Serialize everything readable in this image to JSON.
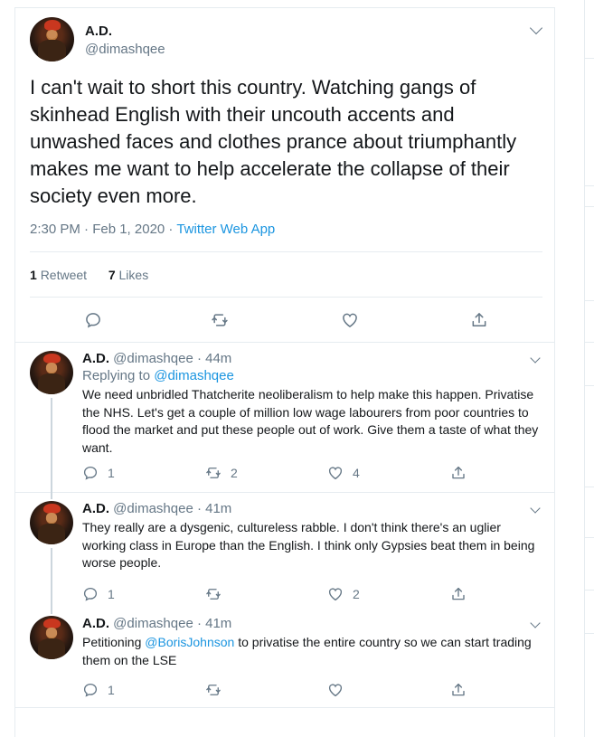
{
  "main_tweet": {
    "name": "A.D.",
    "handle": "@dimashqee",
    "text": "I can't wait to short this country. Watching gangs of skinhead English with their uncouth accents and unwashed faces and clothes prance about triumphantly makes me want to help accelerate the collapse of their society even more.",
    "timestamp": "2:30 PM · Feb 1, 2020 · ",
    "source": "Twitter Web App",
    "retweet_count": "1",
    "retweet_label": "Retweet",
    "like_count": "7",
    "like_label": "Likes"
  },
  "replies": [
    {
      "name": "A.D.",
      "handle_time": "@dimashqee · 44m",
      "replying_prefix": "Replying to ",
      "replying_handle": "@dimashqee",
      "text": "We need unbridled Thatcherite neoliberalism to help make this happen. Privatise the NHS. Let's get a couple of million low wage labourers from poor countries to flood the market and put these people out of work. Give them a taste of what they want.",
      "reply_count": "1",
      "retweet_count": "2",
      "like_count": "4"
    },
    {
      "name": "A.D.",
      "handle_time": "@dimashqee · 41m",
      "text": "They really are a dysgenic, cultureless rabble. I don't think there's an uglier working class in Europe than the English. I think only Gypsies beat them in being worse people.",
      "reply_count": "1",
      "retweet_count": "",
      "like_count": "2"
    },
    {
      "name": "A.D.",
      "handle_time": "@dimashqee · 41m",
      "text_before": "Petitioning ",
      "mention": "@BorisJohnson",
      "text_after": " to privatise the entire country so we can start trading them on the LSE",
      "reply_count": "1",
      "retweet_count": "",
      "like_count": ""
    }
  ],
  "icons": {
    "reply": "reply-icon",
    "retweet": "retweet-icon",
    "like": "heart-icon",
    "share": "share-icon",
    "more": "chevron-down-icon"
  },
  "colors": {
    "link": "#1b95e0",
    "secondary_text": "#657786",
    "primary_text": "#14171a",
    "border": "#e6ecf0"
  }
}
